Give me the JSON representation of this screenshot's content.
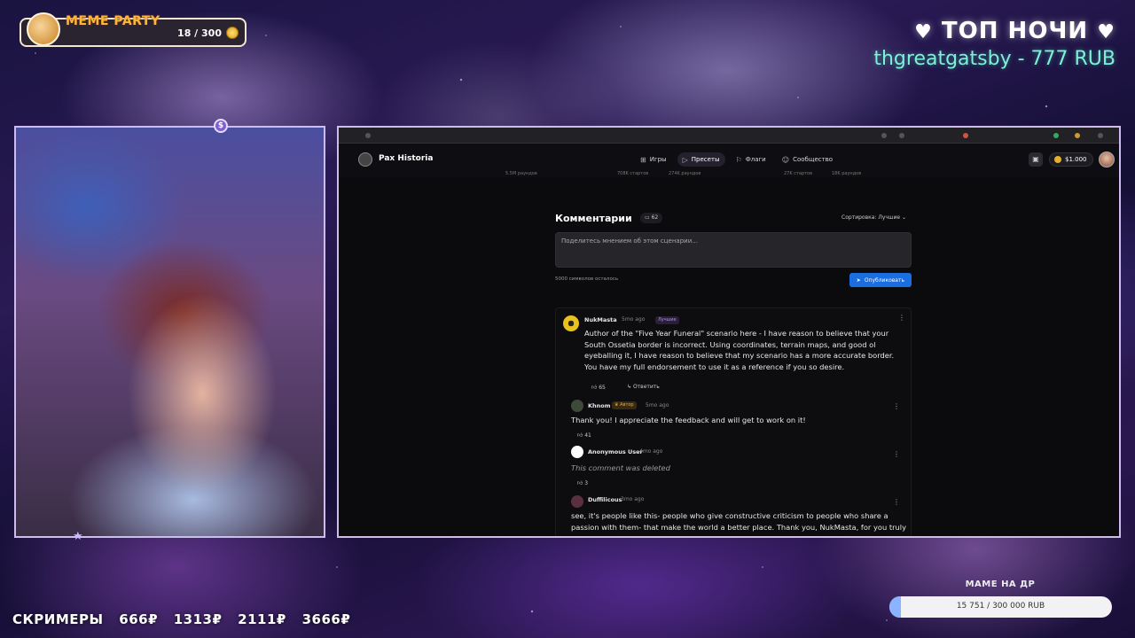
{
  "overlay": {
    "meme_party": {
      "title": "MEME PARTY",
      "count": "18 / 300"
    },
    "top_night": {
      "title": "ТОП НОЧИ",
      "name": "thgreatgatsby - 777 RUB"
    },
    "screamers": {
      "label": "СКРИМЕРЫ",
      "prices": [
        "666₽",
        "1313₽",
        "2111₽",
        "3666₽"
      ]
    },
    "goal": {
      "label": "МАМЕ НА ДР",
      "text": "15 751 / 300 000 RUB",
      "progress_fraction": 0.0525,
      "fill_color": "#8ab4ff"
    }
  },
  "site": {
    "logo": "Pax Historia",
    "nav": [
      {
        "label": "Игры",
        "icon": "gamepad-icon"
      },
      {
        "label": "Пресеты",
        "icon": "play-icon",
        "active": true
      },
      {
        "label": "Флаги",
        "icon": "flag-icon"
      },
      {
        "label": "Сообщество",
        "icon": "users-icon"
      }
    ],
    "balance": "$1.000",
    "stats": [
      "5.5M раундов",
      "708K стартов",
      "274K раундов",
      "27K стартов",
      "18K раундов"
    ],
    "comments": {
      "title": "Комментарии",
      "count": "62",
      "sort": "Сортировка: Лучшие",
      "placeholder": "Поделитесь мнением об этом сценарии...",
      "chars_left": "5000 символов осталось",
      "publish": "Опубликовать"
    },
    "thread": [
      {
        "author": "NukMasta",
        "time": "5mo ago",
        "badge": "Лучшие",
        "body": "Author of the \"Five Year Funeral\" scenario here - I have reason to believe that your South Ossetia border is incorrect. Using coordinates, terrain maps, and good ol eyeballing it, I have reason to believe that my scenario has a more accurate border. You have my full endorsement to use it as a reference if you so desire.",
        "likes": "65",
        "reply": "Ответить"
      },
      {
        "author": "Khnom",
        "time": "5mo ago",
        "badge": "Автор",
        "body": "Thank you! I appreciate the feedback and will get to work on it!",
        "likes": "41"
      },
      {
        "author": "Anonymous User",
        "time": "4mo ago",
        "body": "This comment was deleted",
        "likes": "3"
      },
      {
        "author": "Duffilicous",
        "time": "3mo ago",
        "body": "see, it's people like this- people who give constructive criticism to people who share a passion with them- that make the world a better place. Thank you, NukMasta, for you truly"
      }
    ]
  }
}
